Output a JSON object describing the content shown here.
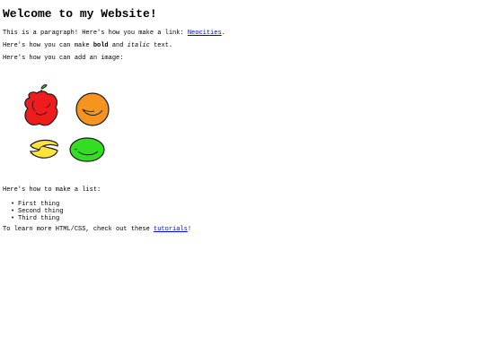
{
  "heading": "Welcome to my Website!",
  "para_link": {
    "text": "This is a paragraph! Here's how you make a link: ",
    "link_label": "Neocities",
    "end": "."
  },
  "para_bold": {
    "text_before": "Here's how you can make ",
    "bold_word": "bold",
    "middle": " and ",
    "italic_word": "italic",
    "end": " text."
  },
  "para_image": "Here's how you can add an image:",
  "image": {
    "description_icons": [
      "apple-icon",
      "orange-icon",
      "banana-icon",
      "lime-icon"
    ],
    "colors": {
      "apple": "#ee1c1c",
      "orange": "#f7941d",
      "banana": "#ffe33a",
      "lime": "#33dd22",
      "outline": "#1a1a1a"
    }
  },
  "para_list": "Here's how to make a list:",
  "list_items": [
    "First thing",
    "Second thing",
    "Third thing"
  ],
  "para_tutorial": {
    "text": "To learn more HTML/CSS, check out these ",
    "link_label": "tutorials",
    "end": "!"
  },
  "colors": {
    "link": "#0000ee",
    "text": "#000000",
    "background": "#ffffff"
  }
}
